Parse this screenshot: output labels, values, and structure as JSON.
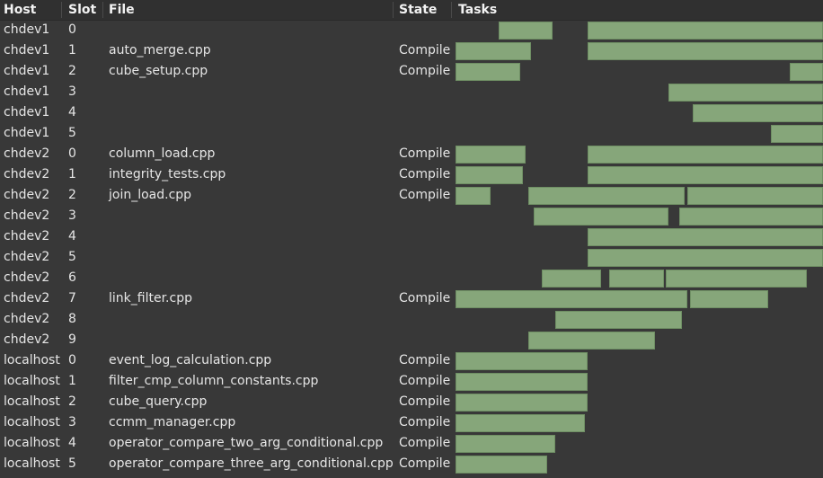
{
  "header": {
    "host": "Host",
    "slot": "Slot",
    "file": "File",
    "state": "State",
    "tasks": "Tasks"
  },
  "rows": [
    {
      "host": "chdev1",
      "slot": "0",
      "file": "",
      "state": ""
    },
    {
      "host": "chdev1",
      "slot": "1",
      "file": "auto_merge.cpp",
      "state": "Compile"
    },
    {
      "host": "chdev1",
      "slot": "2",
      "file": "cube_setup.cpp",
      "state": "Compile"
    },
    {
      "host": "chdev1",
      "slot": "3",
      "file": "",
      "state": ""
    },
    {
      "host": "chdev1",
      "slot": "4",
      "file": "",
      "state": ""
    },
    {
      "host": "chdev1",
      "slot": "5",
      "file": "",
      "state": ""
    },
    {
      "host": "chdev2",
      "slot": "0",
      "file": "column_load.cpp",
      "state": "Compile"
    },
    {
      "host": "chdev2",
      "slot": "1",
      "file": "integrity_tests.cpp",
      "state": "Compile"
    },
    {
      "host": "chdev2",
      "slot": "2",
      "file": "join_load.cpp",
      "state": "Compile"
    },
    {
      "host": "chdev2",
      "slot": "3",
      "file": "",
      "state": ""
    },
    {
      "host": "chdev2",
      "slot": "4",
      "file": "",
      "state": ""
    },
    {
      "host": "chdev2",
      "slot": "5",
      "file": "",
      "state": ""
    },
    {
      "host": "chdev2",
      "slot": "6",
      "file": "",
      "state": ""
    },
    {
      "host": "chdev2",
      "slot": "7",
      "file": "link_filter.cpp",
      "state": "Compile"
    },
    {
      "host": "chdev2",
      "slot": "8",
      "file": "",
      "state": ""
    },
    {
      "host": "chdev2",
      "slot": "9",
      "file": "",
      "state": ""
    },
    {
      "host": "localhost",
      "slot": "0",
      "file": "event_log_calculation.cpp",
      "state": "Compile"
    },
    {
      "host": "localhost",
      "slot": "1",
      "file": "filter_cmp_column_constants.cpp",
      "state": "Compile"
    },
    {
      "host": "localhost",
      "slot": "2",
      "file": "cube_query.cpp",
      "state": "Compile"
    },
    {
      "host": "localhost",
      "slot": "3",
      "file": "ccmm_manager.cpp",
      "state": "Compile"
    },
    {
      "host": "localhost",
      "slot": "4",
      "file": "operator_compare_two_arg_conditional.cpp",
      "state": "Compile"
    },
    {
      "host": "localhost",
      "slot": "5",
      "file": "operator_compare_three_arg_conditional.cpp",
      "state": "Compile"
    }
  ],
  "colors": {
    "background": "#383838",
    "header_background": "#303030",
    "task_bar": "#86a67a",
    "text": "#e6e6e6"
  }
}
